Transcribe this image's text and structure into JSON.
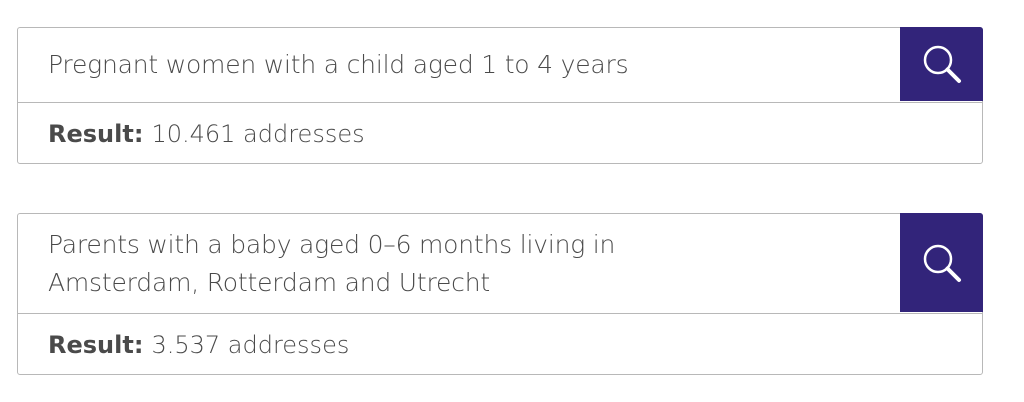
{
  "searches": [
    {
      "query": "Pregnant women with a child aged 1 to 4 years",
      "result_label": "Result:",
      "result_value": "10.461 addresses",
      "search_icon": "search-icon"
    },
    {
      "query": "Parents with a baby aged 0–6 months living in Amsterdam, Rotterdam and Utrecht",
      "result_label": "Result:",
      "result_value": "3.537 addresses",
      "search_icon": "search-icon"
    }
  ],
  "colors": {
    "button_bg": "#32247a",
    "icon": "#ffffff",
    "border": "#b8b8b8",
    "text": "#4a4a4a"
  }
}
